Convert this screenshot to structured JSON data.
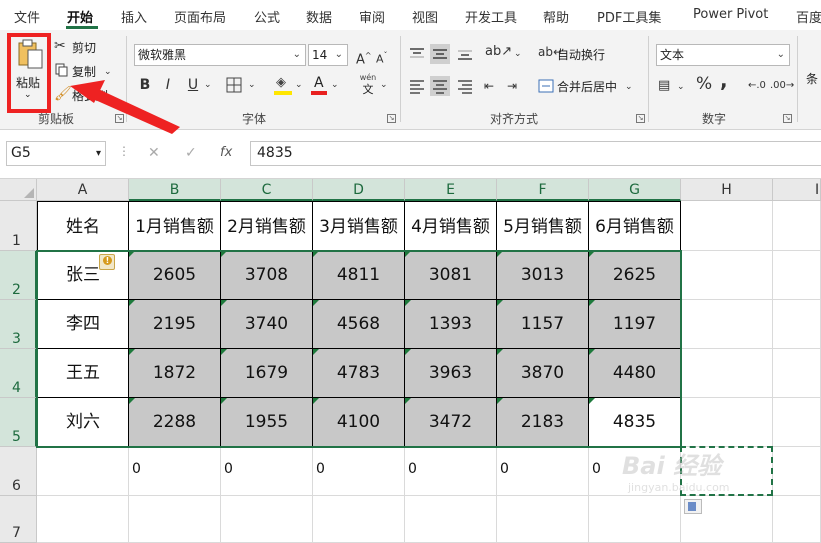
{
  "ribbon_tabs": [
    "文件",
    "开始",
    "插入",
    "页面布局",
    "公式",
    "数据",
    "审阅",
    "视图",
    "开发工具",
    "帮助",
    "PDF工具集",
    "Power Pivot",
    "百度"
  ],
  "clipboard": {
    "paste_label": "粘贴",
    "cut_label": "剪切",
    "copy_label": "复制",
    "format_painter_label": "格式刷",
    "group_label": "剪贴板"
  },
  "font": {
    "name": "微软雅黑",
    "size": "14",
    "group_label": "字体",
    "bold": "B",
    "italic": "I",
    "underline": "U",
    "font_color_glyph": "A",
    "phonetic_top": "wén",
    "phonetic_bottom": "文"
  },
  "alignment": {
    "wrap_text": "自动换行",
    "merge_center": "合并后居中",
    "group_label": "对齐方式"
  },
  "number": {
    "format": "文本",
    "group_label": "数字",
    "percent": "%",
    "comma": ","
  },
  "styles": {
    "label": "条"
  },
  "formula_bar": {
    "name_box": "G5",
    "fx": "fx",
    "value": "4835"
  },
  "colors": {
    "accent": "#217346",
    "selection_fill": "#c8c8c8",
    "highlight": "#ee2222"
  },
  "icons": [
    "clipboard-icon",
    "scissors-icon",
    "copy-icon",
    "paintbrush-icon",
    "dropdown-icon",
    "warning-icon",
    "paste-options-icon"
  ],
  "columns": [
    "A",
    "B",
    "C",
    "D",
    "E",
    "F",
    "G",
    "H",
    "I"
  ],
  "rows": [
    "1",
    "2",
    "3",
    "4",
    "5",
    "6",
    "7"
  ],
  "sheet": {
    "headers": [
      "姓名",
      "1月销售额",
      "2月销售额",
      "3月销售额",
      "4月销售额",
      "5月销售额",
      "6月销售额"
    ],
    "data": [
      [
        "张三",
        "2605",
        "3708",
        "4811",
        "3081",
        "3013",
        "2625"
      ],
      [
        "李四",
        "2195",
        "3740",
        "4568",
        "1393",
        "1157",
        "1197"
      ],
      [
        "王五",
        "1872",
        "1679",
        "4783",
        "3963",
        "3870",
        "4480"
      ],
      [
        "刘六",
        "2288",
        "1955",
        "4100",
        "3472",
        "2183",
        "4835"
      ]
    ],
    "row6": [
      "0",
      "0",
      "0",
      "0",
      "0",
      "0"
    ]
  },
  "watermark": {
    "main": "Bai 经验",
    "sub": "jingyan.baidu.com"
  }
}
